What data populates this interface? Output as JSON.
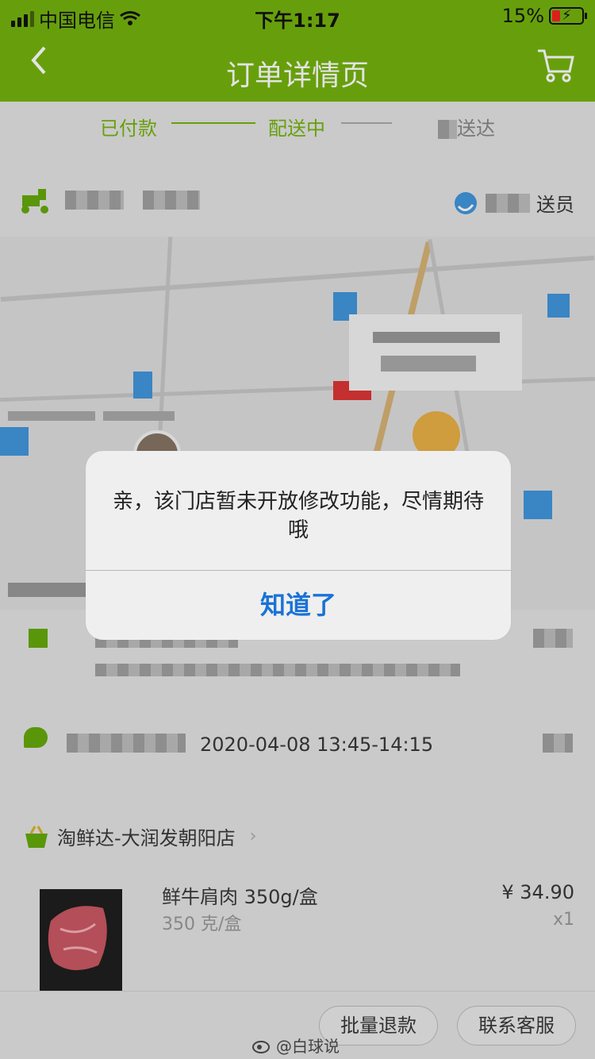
{
  "status_bar": {
    "carrier": "中国电信",
    "time": "下午1:17",
    "battery": "15%"
  },
  "nav": {
    "back_icon": "chevron-left-icon",
    "title": "订单详情页",
    "cart_icon": "cart-icon"
  },
  "progress": {
    "step1": "已付款",
    "step2": "配送中",
    "step3": "送达"
  },
  "rider": {
    "contact_label": "送员"
  },
  "delivery": {
    "time_slot": "2020-04-08 13:45-14:15"
  },
  "store": {
    "name": "淘鲜达-大润发朝阳店",
    "item": {
      "name": "鲜牛肩肉 350g/盒",
      "spec": "350 克/盒",
      "price": "¥ 34.90",
      "qty": "x1"
    }
  },
  "actions": {
    "refund": "批量退款",
    "service": "联系客服"
  },
  "watermark": "@白球说",
  "dialog": {
    "message": "亲，该门店暂未开放修改功能，尽情期待哦",
    "ok": "知道了"
  },
  "colors": {
    "brand_green": "#6aa30d",
    "link_blue": "#1a73d6"
  }
}
